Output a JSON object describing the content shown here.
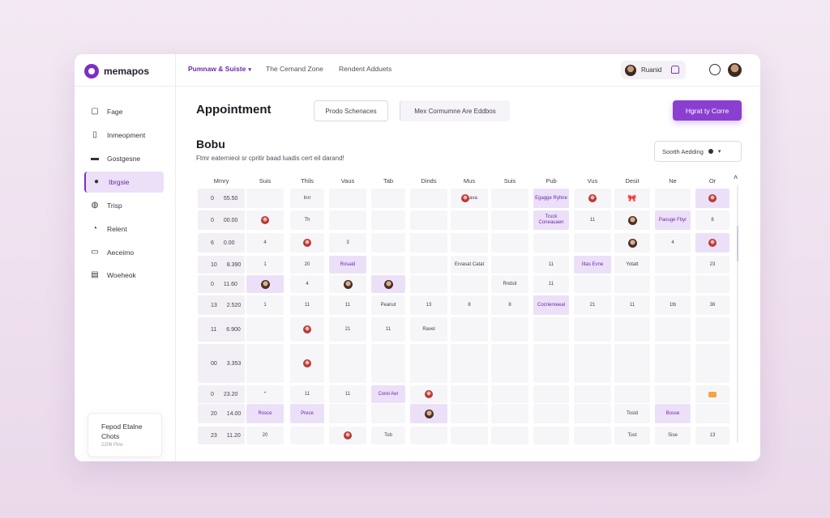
{
  "app": {
    "name": "memapos"
  },
  "topnav": [
    {
      "label": "Pumnaw & Suiste",
      "active": true
    },
    {
      "label": "The Cemand Zone",
      "active": false
    },
    {
      "label": "Rendent Adduets",
      "active": false
    }
  ],
  "user": {
    "name": "Ruanid"
  },
  "sidebar": [
    {
      "label": "Fage",
      "icon": "file-icon"
    },
    {
      "label": "Inmeopment",
      "icon": "document-icon"
    },
    {
      "label": "Gostgesne",
      "icon": "folder-icon"
    },
    {
      "label": "Ibrgsie",
      "icon": "person-icon",
      "active": true
    },
    {
      "label": "Trisp",
      "icon": "chat-icon"
    },
    {
      "label": "Relent",
      "icon": "clock-icon"
    },
    {
      "label": "Aeceimo",
      "icon": "note-icon"
    },
    {
      "label": "Woeheok",
      "icon": "book-icon"
    }
  ],
  "promo": {
    "title": "Fepod Etalne\nChots",
    "sub": "2206 Pins"
  },
  "page": {
    "title": "Appointment",
    "btn_a": "Prodo Schenaces",
    "btn_b": "Mex Cormumne Are Eddbos",
    "primary": "Hgrat ty Corre",
    "section_title": "Bobu",
    "section_sub": "Ftmr eaternieol sr cpritir baad luadis cert eil darand!",
    "sort": "Sootth Aedding"
  },
  "grid": {
    "columns": [
      "Mmry",
      "Suis",
      "Thils",
      "Vaus",
      "Tab",
      "Dinds",
      "Mus",
      "Suis",
      "Pub",
      "Vus",
      "Desit",
      "Ne",
      "Or"
    ],
    "rows": [
      {
        "num": "0",
        "time": "55.50",
        "cells": [
          {
            "t": ""
          },
          {
            "t": "Inrr"
          },
          {
            "t": ""
          },
          {
            "t": ""
          },
          {
            "t": ""
          },
          {
            "t": "ava",
            "c": "pin"
          },
          {
            "t": ""
          },
          {
            "t": "Egagge Ryhne",
            "c": "purple"
          },
          {
            "t": "",
            "c": "pin"
          },
          {
            "t": "",
            "c": "ribbon"
          },
          {
            "t": ""
          },
          {
            "t": "",
            "c": "pin-purple"
          }
        ]
      },
      {
        "num": "0",
        "time": "00.00",
        "cells": [
          {
            "t": "",
            "c": "pin"
          },
          {
            "t": "Th"
          },
          {
            "t": ""
          },
          {
            "t": ""
          },
          {
            "t": ""
          },
          {
            "t": ""
          },
          {
            "t": ""
          },
          {
            "t": "Truck Coneauaen",
            "c": "purple"
          },
          {
            "t": "11"
          },
          {
            "t": "",
            "c": "face"
          },
          {
            "t": "Paouge Fbyr",
            "c": "purple"
          },
          {
            "t": "8"
          }
        ]
      },
      {
        "num": "6",
        "time": "0.00",
        "cells": [
          {
            "t": "4"
          },
          {
            "t": "",
            "c": "pin"
          },
          {
            "t": "3"
          },
          {
            "t": ""
          },
          {
            "t": ""
          },
          {
            "t": ""
          },
          {
            "t": ""
          },
          {
            "t": ""
          },
          {
            "t": ""
          },
          {
            "t": "",
            "c": "face"
          },
          {
            "t": "4"
          },
          {
            "t": "",
            "c": "pin-purple"
          }
        ]
      },
      {
        "num": "10",
        "time": "8.390",
        "cells": [
          {
            "t": "1"
          },
          {
            "t": "20"
          },
          {
            "t": "Rosaid",
            "c": "purple"
          },
          {
            "t": ""
          },
          {
            "t": ""
          },
          {
            "t": "Ervasat Catat"
          },
          {
            "t": ""
          },
          {
            "t": "11"
          },
          {
            "t": "Iltas Evne",
            "c": "purple"
          },
          {
            "t": "Yotatt"
          },
          {
            "t": ""
          },
          {
            "t": "23"
          }
        ]
      },
      {
        "num": "0",
        "time": "11.60",
        "cells": [
          {
            "t": "",
            "c": "face-purple"
          },
          {
            "t": "4"
          },
          {
            "t": "",
            "c": "face"
          },
          {
            "t": "",
            "c": "face-purple"
          },
          {
            "t": ""
          },
          {
            "t": ""
          },
          {
            "t": "Rndsit"
          },
          {
            "t": "11"
          },
          {
            "t": ""
          },
          {
            "t": ""
          },
          {
            "t": ""
          },
          {
            "t": ""
          }
        ]
      },
      {
        "num": "13",
        "time": "2.520",
        "cells": [
          {
            "t": "1"
          },
          {
            "t": "11"
          },
          {
            "t": "11"
          },
          {
            "t": "Peanut"
          },
          {
            "t": "13"
          },
          {
            "t": "8"
          },
          {
            "t": "8"
          },
          {
            "t": "Cocrienreeal",
            "c": "purple"
          },
          {
            "t": "21"
          },
          {
            "t": "11"
          },
          {
            "t": "1tb"
          },
          {
            "t": "36"
          }
        ]
      },
      {
        "num": "11",
        "time": "6.900",
        "cells": [
          {
            "t": ""
          },
          {
            "t": "",
            "c": "pin"
          },
          {
            "t": "21"
          },
          {
            "t": "11"
          },
          {
            "t": "Ravel"
          },
          {
            "t": ""
          },
          {
            "t": ""
          },
          {
            "t": ""
          },
          {
            "t": ""
          },
          {
            "t": ""
          },
          {
            "t": ""
          },
          {
            "t": ""
          }
        ]
      },
      {
        "num": "00",
        "time": "3.353",
        "cells": [
          {
            "t": ""
          },
          {
            "t": "",
            "c": "pin"
          },
          {
            "t": ""
          },
          {
            "t": ""
          },
          {
            "t": ""
          },
          {
            "t": ""
          },
          {
            "t": ""
          },
          {
            "t": ""
          },
          {
            "t": ""
          },
          {
            "t": ""
          },
          {
            "t": ""
          },
          {
            "t": ""
          }
        ]
      },
      {
        "num": "0",
        "time": "23.20",
        "cells": [
          {
            "t": "*"
          },
          {
            "t": "11"
          },
          {
            "t": "11"
          },
          {
            "t": "Corel Aer",
            "c": "purple"
          },
          {
            "t": "",
            "c": "pin"
          },
          {
            "t": ""
          },
          {
            "t": ""
          },
          {
            "t": ""
          },
          {
            "t": ""
          },
          {
            "t": ""
          },
          {
            "t": ""
          },
          {
            "t": "",
            "c": "badge"
          }
        ]
      },
      {
        "num": "20",
        "time": "14.00",
        "cells": [
          {
            "t": "Rosce",
            "c": "purple"
          },
          {
            "t": "Prece",
            "c": "purple"
          },
          {
            "t": ""
          },
          {
            "t": ""
          },
          {
            "t": "",
            "c": "face-purple"
          },
          {
            "t": ""
          },
          {
            "t": ""
          },
          {
            "t": ""
          },
          {
            "t": ""
          },
          {
            "t": "Tosid"
          },
          {
            "t": "Bosse",
            "c": "purple"
          },
          {
            "t": ""
          }
        ]
      },
      {
        "num": "23",
        "time": "11.20",
        "cells": [
          {
            "t": "20"
          },
          {
            "t": ""
          },
          {
            "t": "",
            "c": "pin"
          },
          {
            "t": "Tob"
          },
          {
            "t": ""
          },
          {
            "t": ""
          },
          {
            "t": ""
          },
          {
            "t": ""
          },
          {
            "t": ""
          },
          {
            "t": "Tost"
          },
          {
            "t": "Sise"
          },
          {
            "t": "13"
          }
        ]
      }
    ]
  },
  "colors": {
    "accent": "#8a3fd0",
    "accent_light": "#ece0f8",
    "cell": "#f6f5f8"
  }
}
